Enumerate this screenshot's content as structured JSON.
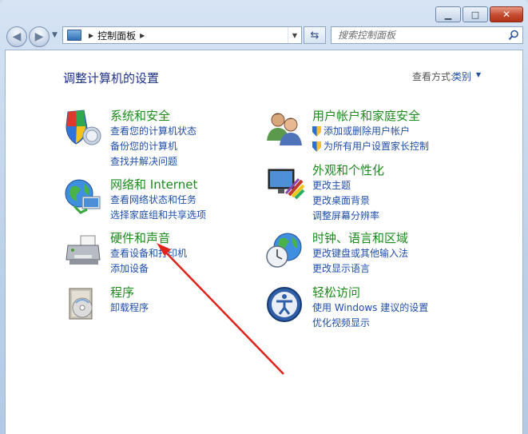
{
  "window": {
    "caption": {
      "minimize": "▁",
      "maximize": "□",
      "close": "✕"
    }
  },
  "nav": {
    "back_icon": "back-arrow",
    "forward_icon": "forward-arrow",
    "address": {
      "crumb": "控制面板"
    },
    "refresh_icon": "refresh",
    "search": {
      "placeholder": "搜索控制面板"
    }
  },
  "content": {
    "title": "调整计算机的设置",
    "view_by_label": "查看方式:",
    "view_by_value": "类别",
    "categories_left": [
      {
        "title": "系统和安全",
        "icon": "system-security-icon",
        "links": [
          {
            "text": "查看您的计算机状态"
          },
          {
            "text": "备份您的计算机"
          },
          {
            "text": "查找并解决问题"
          }
        ]
      },
      {
        "title": "网络和 Internet",
        "icon": "network-internet-icon",
        "links": [
          {
            "text": "查看网络状态和任务"
          },
          {
            "text": "选择家庭组和共享选项"
          }
        ]
      },
      {
        "title": "硬件和声音",
        "icon": "hardware-sound-icon",
        "links": [
          {
            "text": "查看设备和打印机"
          },
          {
            "text": "添加设备"
          }
        ]
      },
      {
        "title": "程序",
        "icon": "programs-icon",
        "links": [
          {
            "text": "卸载程序"
          }
        ]
      }
    ],
    "categories_right": [
      {
        "title": "用户帐户和家庭安全",
        "icon": "user-accounts-icon",
        "links": [
          {
            "text": "添加或删除用户帐户",
            "shield": true
          },
          {
            "text": "为所有用户设置家长控制",
            "shield": true
          }
        ]
      },
      {
        "title": "外观和个性化",
        "icon": "appearance-icon",
        "links": [
          {
            "text": "更改主题"
          },
          {
            "text": "更改桌面背景"
          },
          {
            "text": "调整屏幕分辨率"
          }
        ]
      },
      {
        "title": "时钟、语言和区域",
        "icon": "clock-language-icon",
        "links": [
          {
            "text": "更改键盘或其他输入法"
          },
          {
            "text": "更改显示语言"
          }
        ]
      },
      {
        "title": "轻松访问",
        "icon": "ease-of-access-icon",
        "links": [
          {
            "text": "使用 Windows 建议的设置"
          },
          {
            "text": "优化视频显示"
          }
        ]
      }
    ]
  },
  "annotation": {
    "arrow_color": "#e0231b"
  }
}
